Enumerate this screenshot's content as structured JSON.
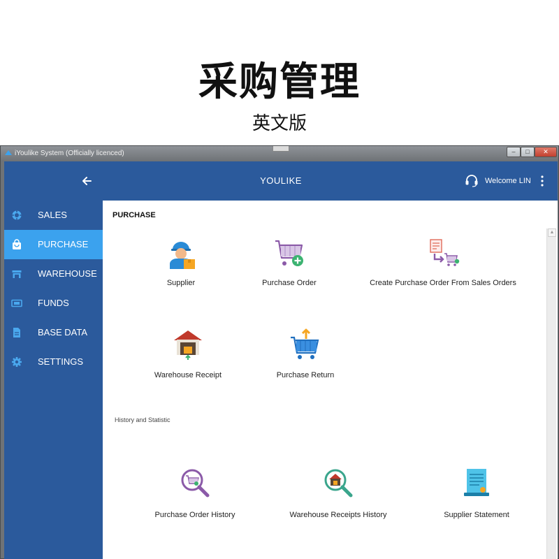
{
  "banner": {
    "title": "采购管理",
    "subtitle": "英文版"
  },
  "window": {
    "title": "iYoulike System (Officially licenced)"
  },
  "header": {
    "brand": "YOULIKE",
    "welcome": "Welcome LIN"
  },
  "sidebar": {
    "items": [
      {
        "label": "SALES",
        "icon": "sales-icon"
      },
      {
        "label": "PURCHASE",
        "icon": "shopping-bag-icon",
        "active": true
      },
      {
        "label": "WAREHOUSE",
        "icon": "warehouse-icon"
      },
      {
        "label": "FUNDS",
        "icon": "money-icon"
      },
      {
        "label": "BASE DATA",
        "icon": "document-icon"
      },
      {
        "label": "SETTINGS",
        "icon": "gear-icon"
      }
    ]
  },
  "content": {
    "section_title": "PURCHASE",
    "tiles": [
      {
        "label": "Supplier",
        "icon": "supplier-worker-icon"
      },
      {
        "label": "Purchase Order",
        "icon": "cart-add-icon"
      },
      {
        "label": "Create Purchase Order From Sales Orders",
        "icon": "convert-order-icon"
      },
      {
        "label": "Warehouse Receipt",
        "icon": "warehouse-receipt-icon"
      },
      {
        "label": "Purchase Return",
        "icon": "cart-return-icon"
      }
    ],
    "history_title": "History and Statistic",
    "history_tiles": [
      {
        "label": "Purchase Order History",
        "icon": "search-cart-icon"
      },
      {
        "label": "Warehouse Receipts History",
        "icon": "search-warehouse-icon"
      },
      {
        "label": "Supplier Statement",
        "icon": "statement-icon"
      }
    ]
  },
  "colors": {
    "header": "#2b5a9c",
    "sidebar": "#2b5a9c",
    "active_item": "#3ba2ee",
    "content_bg": "#ffffff"
  }
}
